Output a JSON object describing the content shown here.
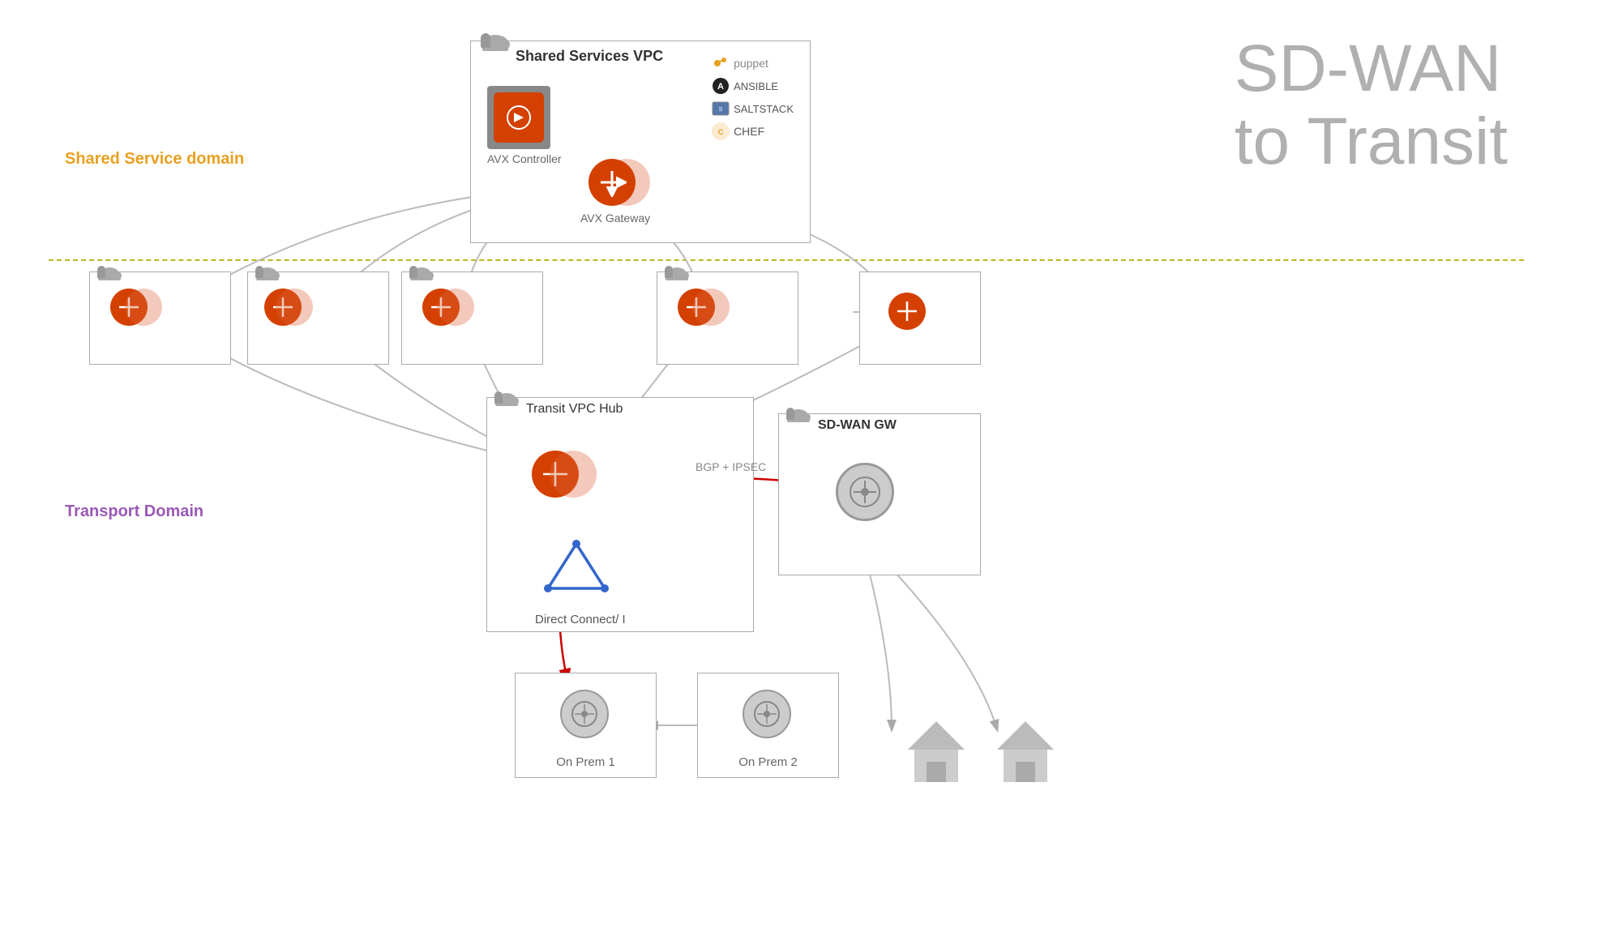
{
  "title": {
    "line1": "SD-WAN",
    "line2": "to Transit"
  },
  "domains": {
    "shared": "Shared Service domain",
    "transport": "Transport Domain"
  },
  "boxes": {
    "shared_services": {
      "title": "Shared Services VPC",
      "avx_controller_label": "AVX Controller",
      "avx_gateway_label": "AVX Gateway"
    },
    "transit_hub": {
      "title": "Transit VPC Hub"
    },
    "sdwan_gw": {
      "title": "SD-WAN GW"
    },
    "on_prem1": "On Prem 1",
    "on_prem2": "On Prem 2"
  },
  "labels": {
    "bgp_ipsec": "BGP + IPSEC",
    "direct_connect": "Direct Connect/ I"
  },
  "tools": [
    "puppet",
    "ANSIBLE",
    "SALTSTACK",
    "CHEF"
  ]
}
